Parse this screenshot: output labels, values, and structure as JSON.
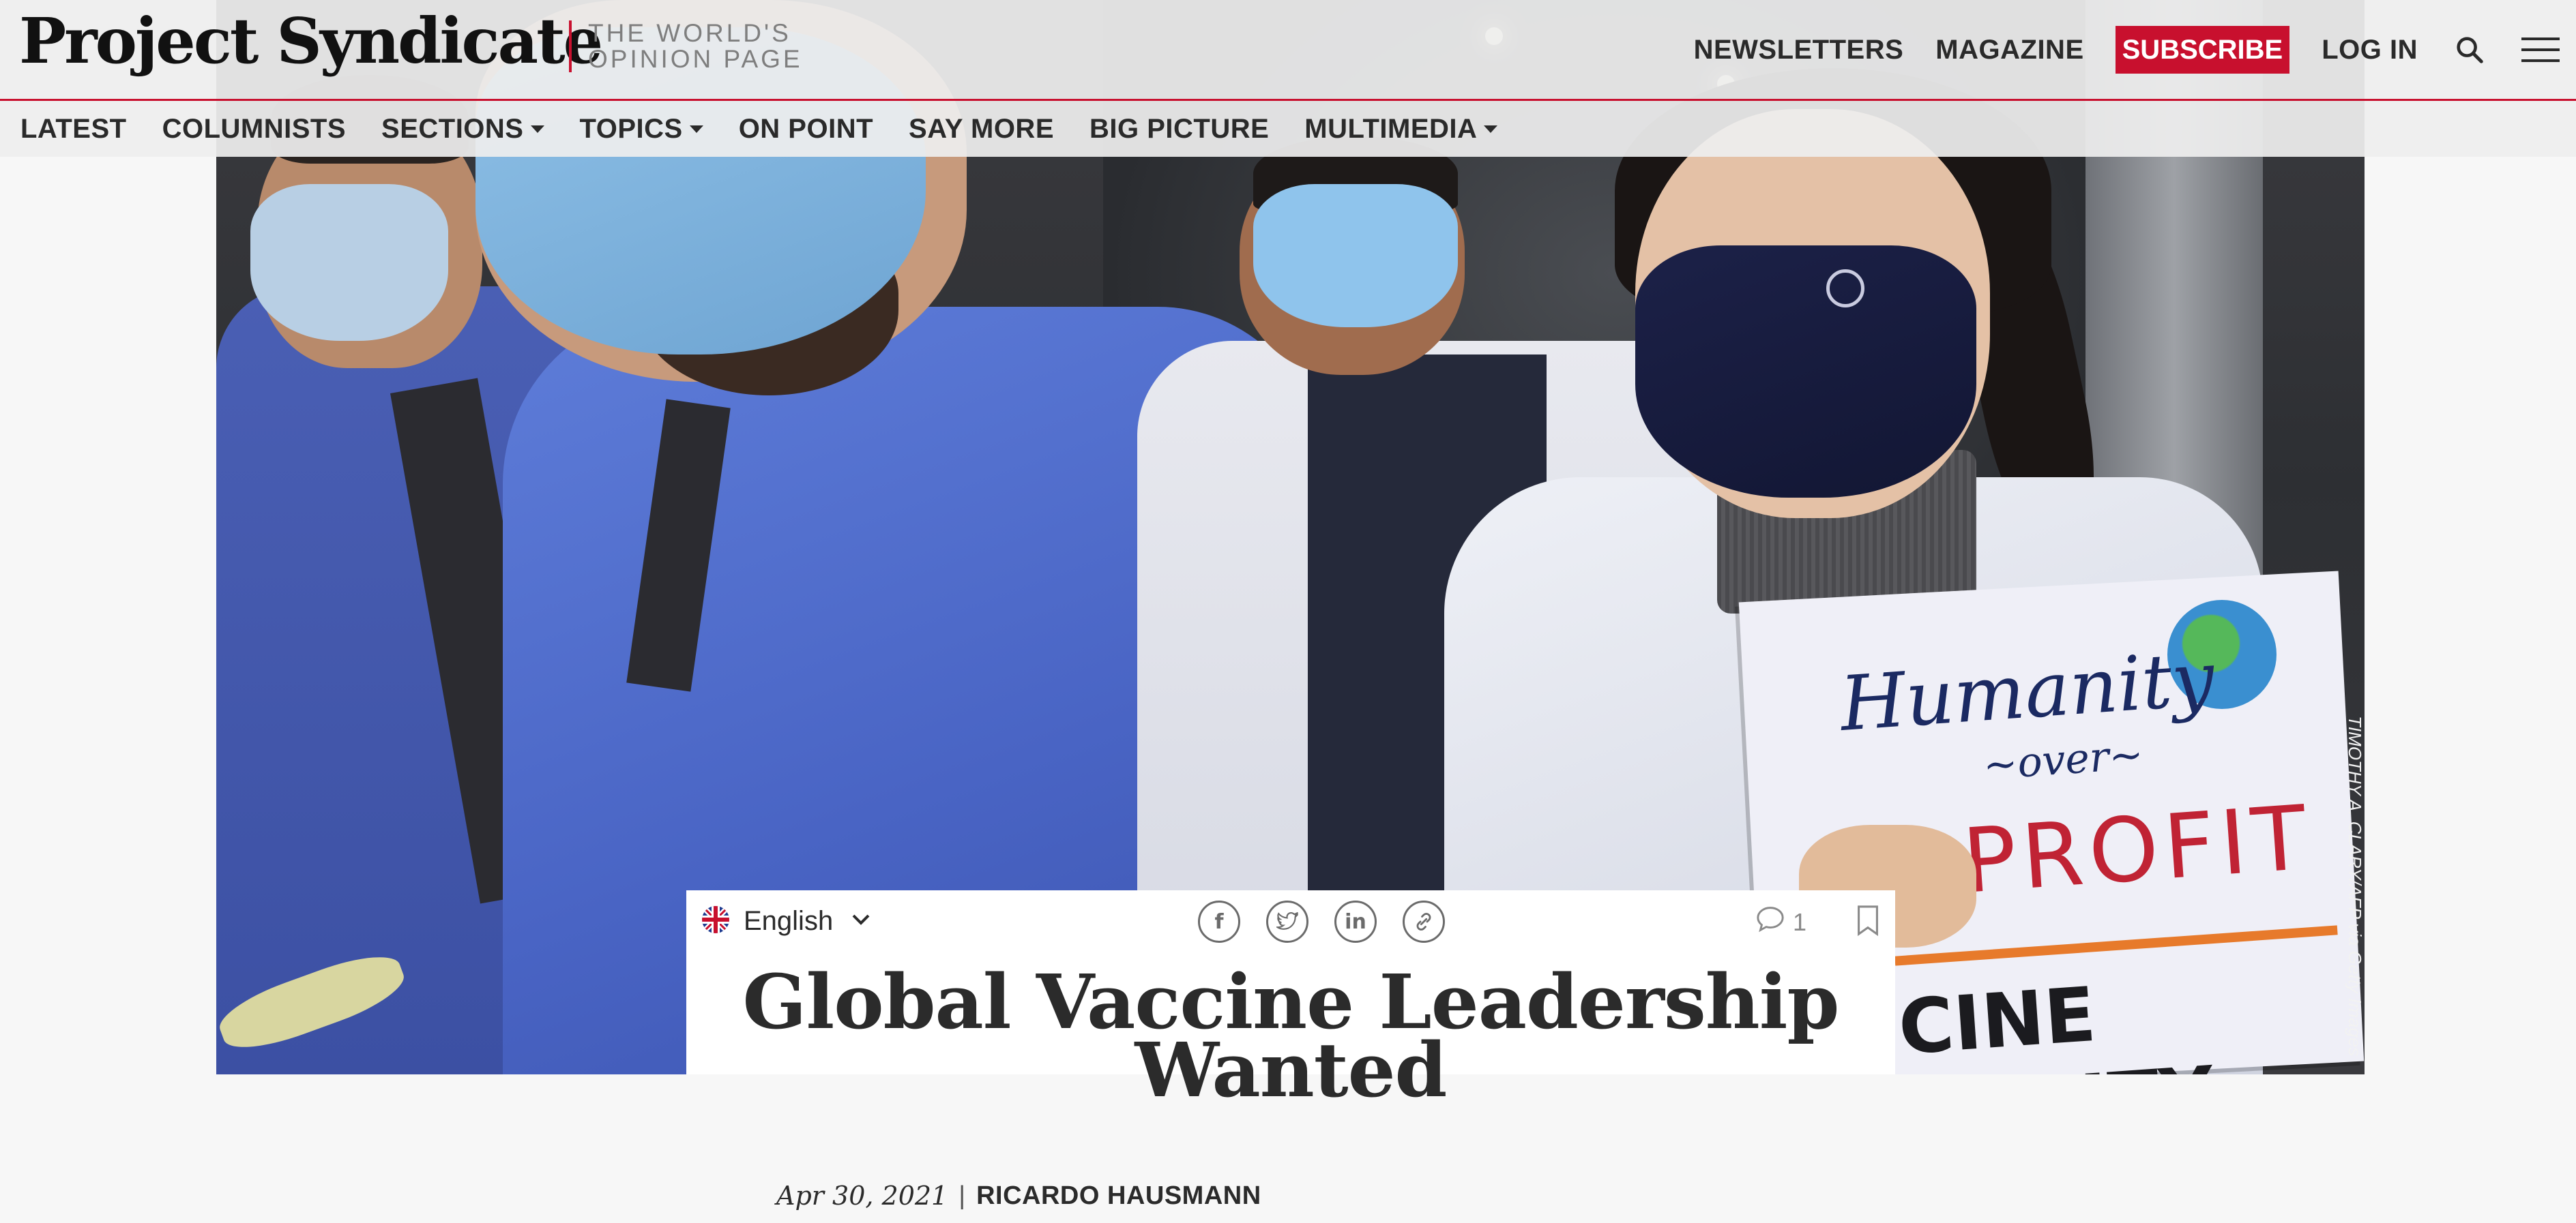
{
  "header": {
    "logo": "Project Syndicate",
    "tagline_line1": "THE WORLD'S",
    "tagline_line2": "OPINION PAGE",
    "links": {
      "newsletters": "NEWSLETTERS",
      "magazine": "MAGAZINE",
      "subscribe": "SUBSCRIBE",
      "login": "LOG IN"
    },
    "icons": {
      "search": "search-icon",
      "menu": "hamburger-menu-icon"
    },
    "accent_color": "#c8102e"
  },
  "nav": {
    "items": [
      {
        "label": "LATEST",
        "has_dropdown": false
      },
      {
        "label": "COLUMNISTS",
        "has_dropdown": false
      },
      {
        "label": "SECTIONS",
        "has_dropdown": true
      },
      {
        "label": "TOPICS",
        "has_dropdown": true
      },
      {
        "label": "ON POINT",
        "has_dropdown": false
      },
      {
        "label": "SAY MORE",
        "has_dropdown": false
      },
      {
        "label": "BIG PICTURE",
        "has_dropdown": false
      },
      {
        "label": "MULTIMEDIA",
        "has_dropdown": true
      }
    ]
  },
  "hero": {
    "credit": "TIMOTHY A. CLARY/AFP via Getty Images",
    "sign_line1": "Humanity",
    "sign_line2": "~over~",
    "sign_line3": "PROFIT",
    "sign_line4": "CINE EQUITY"
  },
  "article": {
    "language": "English",
    "language_icon": "uk-flag-icon",
    "share_icons": [
      "facebook-icon",
      "twitter-icon",
      "linkedin-icon",
      "copy-link-icon"
    ],
    "comment_count": "1",
    "title_line1": "Global Vaccine Leadership",
    "title_line2": "Wanted",
    "date": "Apr 30, 2021",
    "separator": "|",
    "author": "RICARDO HAUSMANN"
  }
}
